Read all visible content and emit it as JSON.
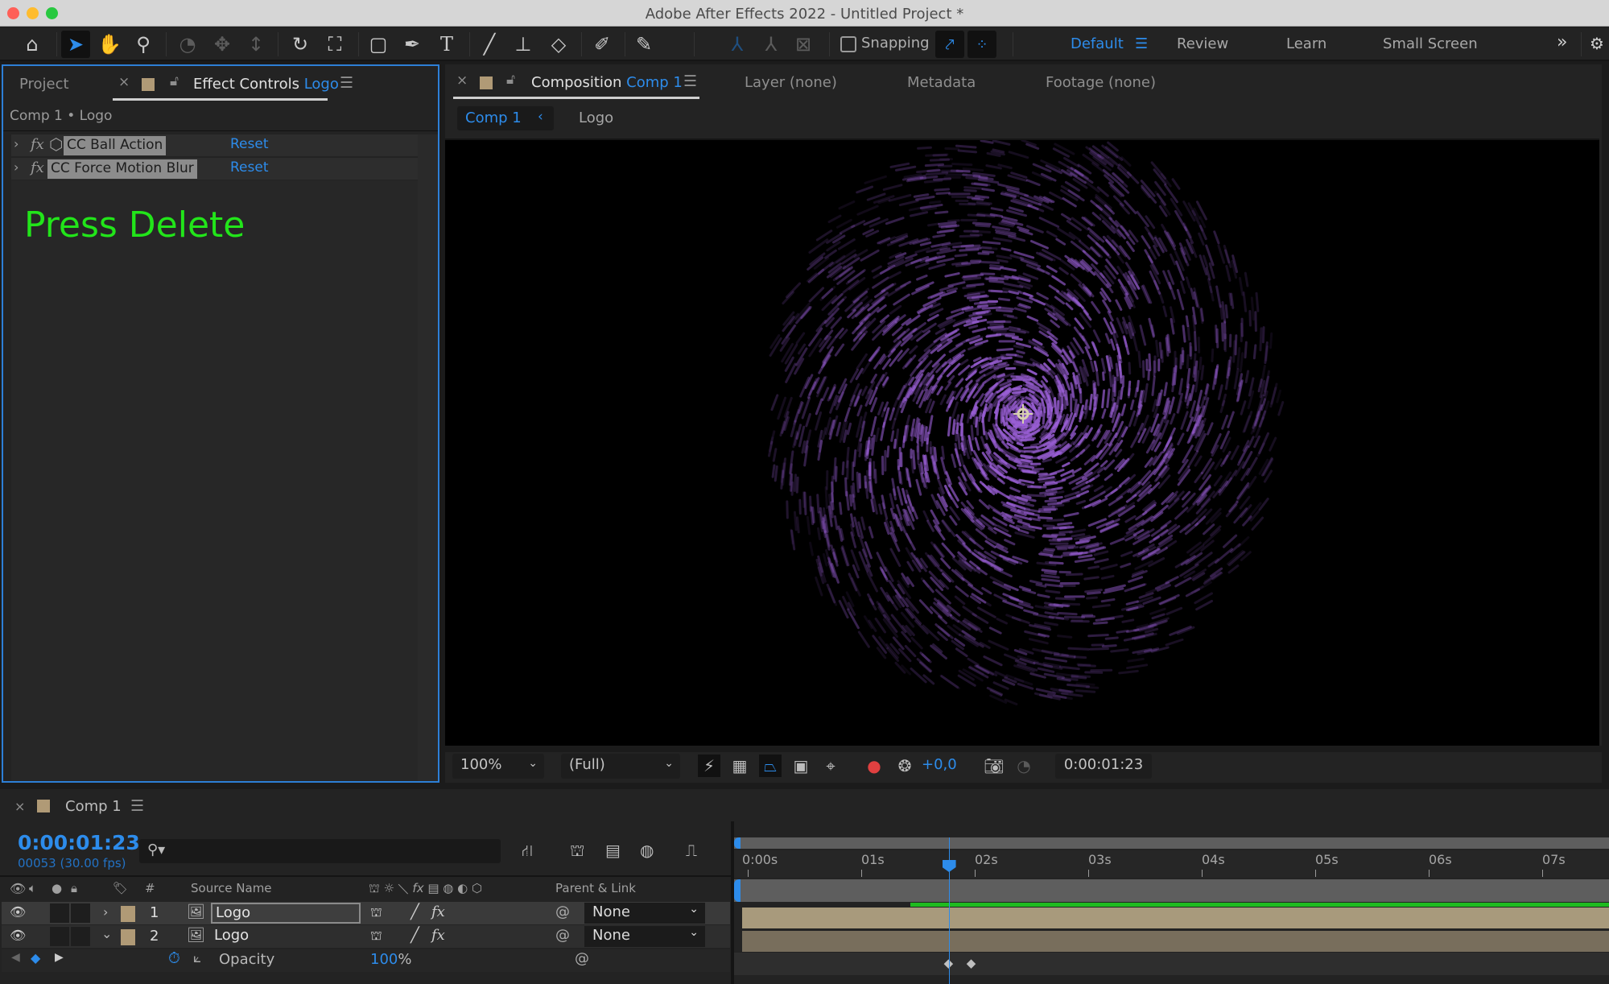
{
  "window": {
    "title": "Adobe After Effects 2022 - Untitled Project *",
    "traffic_lights": {
      "close": "#ff5f57",
      "minimize": "#febc2e",
      "zoom": "#28c840"
    }
  },
  "toolbar": {
    "tools": [
      {
        "name": "home-icon",
        "glyph": "⌂"
      },
      {
        "name": "selection-tool-icon",
        "glyph": "➤"
      },
      {
        "name": "hand-tool-icon",
        "glyph": "✋"
      },
      {
        "name": "zoom-tool-icon",
        "glyph": "⚲"
      },
      {
        "name": "orbit-camera-icon",
        "glyph": "◔"
      },
      {
        "name": "pan-camera-icon",
        "glyph": "✥"
      },
      {
        "name": "dolly-camera-icon",
        "glyph": "↕"
      },
      {
        "name": "rotation-tool-icon",
        "glyph": "↻"
      },
      {
        "name": "pan-behind-tool-icon",
        "glyph": "⛶"
      },
      {
        "name": "rectangle-tool-icon",
        "glyph": "▢"
      },
      {
        "name": "pen-tool-icon",
        "glyph": "✒"
      },
      {
        "name": "type-tool-icon",
        "glyph": "T"
      },
      {
        "name": "brush-tool-icon",
        "glyph": "🖌"
      },
      {
        "name": "clone-stamp-tool-icon",
        "glyph": "⊥"
      },
      {
        "name": "eraser-tool-icon",
        "glyph": "◇"
      },
      {
        "name": "roto-brush-tool-icon",
        "glyph": "✐"
      },
      {
        "name": "puppet-pin-tool-icon",
        "glyph": "📌"
      }
    ],
    "axis_tools": [
      "local-axis-icon",
      "world-axis-icon",
      "view-axis-icon"
    ],
    "snapping_label": "Snapping",
    "snapping_checked": false,
    "workspaces": [
      "Default",
      "Review",
      "Learn",
      "Small Screen"
    ],
    "active_workspace": "Default",
    "overflow_glyph": "»"
  },
  "left_panel": {
    "tabs": [
      {
        "label": "Project"
      },
      {
        "label": "Effect Controls",
        "accent": "Logo"
      }
    ],
    "breadcrumb": "Comp 1 • Logo",
    "effects": [
      {
        "name": "CC Ball Action",
        "reset": "Reset",
        "has_3d_icon": true
      },
      {
        "name": "CC Force Motion Blur",
        "reset": "Reset",
        "has_3d_icon": false
      }
    ],
    "overlay_text": "Press Delete",
    "overlay_color": "#22e51a"
  },
  "comp_panel": {
    "tab_label": "Composition",
    "tab_accent": "Comp 1",
    "other_tabs": [
      "Layer (none)",
      "Metadata",
      "Footage (none)"
    ],
    "nav": {
      "comp": "Comp 1",
      "layer": "Logo"
    },
    "viewer": {
      "zoom": "100%",
      "resolution": "(Full)",
      "exposure": "+0,0",
      "timecode": "0:00:01:23",
      "particle_color": "#9a5fd6"
    }
  },
  "timeline": {
    "tab_label": "Comp 1",
    "timecode": "0:00:01:23",
    "frame_info": "00053 (30.00 fps)",
    "search_placeholder": "",
    "columns": {
      "number": "#",
      "source_name": "Source Name",
      "parent_link": "Parent & Link"
    },
    "layers": [
      {
        "index": "1",
        "name": "Logo",
        "parent": "None",
        "expanded": false,
        "selected": true
      },
      {
        "index": "2",
        "name": "Logo",
        "parent": "None",
        "expanded": true,
        "selected": false
      }
    ],
    "property": {
      "name": "Opacity",
      "value": "100",
      "unit": "%"
    },
    "ruler": [
      "0:00s",
      "01s",
      "02s",
      "03s",
      "04s",
      "05s",
      "06s",
      "07s"
    ],
    "current_time_seconds": 1.77,
    "keyframes_seconds": [
      1.77,
      1.97
    ],
    "work_area_bar_color": "#1fbb1f",
    "layer_bar_color": "#a89a7c"
  }
}
